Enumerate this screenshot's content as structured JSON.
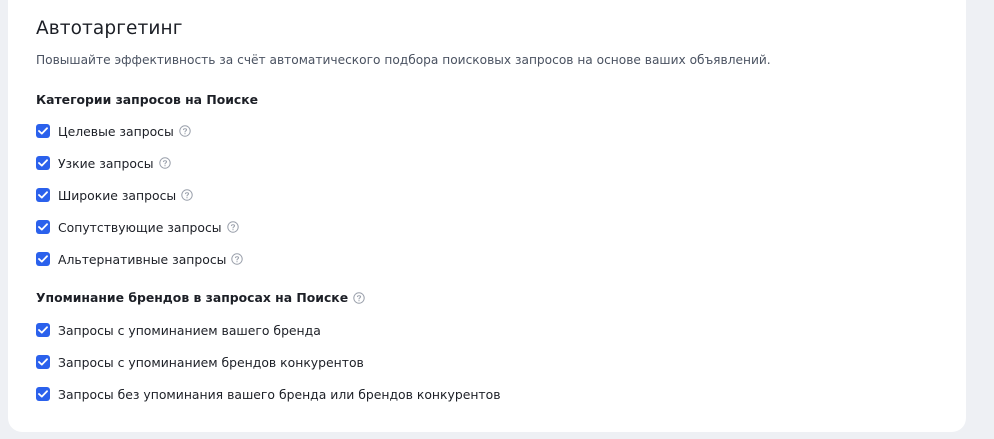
{
  "colors": {
    "accent": "#2b61ec",
    "text": "#1c1f26",
    "muted": "#4a5261",
    "help_icon": "#9aa0ab",
    "background": "#eef0f4",
    "card": "#ffffff"
  },
  "title": "Автотаргетинг",
  "subtitle": "Повышайте эффективность за счёт автоматического подбора поисковых запросов на основе ваших объявлений.",
  "search_categories": {
    "title": "Категории запросов на Поиске",
    "items": [
      {
        "label": "Целевые запросы",
        "checked": true,
        "icon": "help-icon"
      },
      {
        "label": "Узкие запросы",
        "checked": true,
        "icon": "help-icon"
      },
      {
        "label": "Широкие запросы",
        "checked": true,
        "icon": "help-icon"
      },
      {
        "label": "Сопутствующие запросы",
        "checked": true,
        "icon": "help-icon"
      },
      {
        "label": "Альтернативные запросы",
        "checked": true,
        "icon": "help-icon"
      }
    ]
  },
  "brand_mentions": {
    "title": "Упоминание брендов в запросах на Поиске",
    "icon": "help-icon",
    "items": [
      {
        "label": "Запросы с упоминанием вашего бренда",
        "checked": true
      },
      {
        "label": "Запросы с упоминанием брендов конкурентов",
        "checked": true
      },
      {
        "label": "Запросы без упоминания вашего бренда или брендов конкурентов",
        "checked": true
      }
    ]
  }
}
